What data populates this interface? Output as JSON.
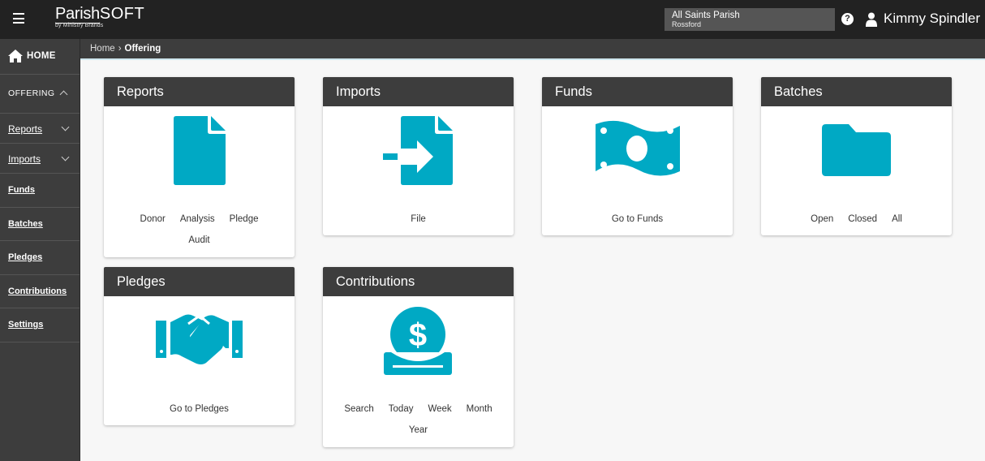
{
  "topbar": {
    "logo_main": "Parish",
    "logo_soft": "SOFT",
    "logo_by": "by Ministry Brands",
    "parish_name": "All Saints Parish",
    "parish_sub": "Rossford",
    "help_glyph": "?",
    "user_name": "Kimmy Spindler"
  },
  "sidebar": {
    "home": "HOME",
    "offering": "OFFERING",
    "items": [
      "Reports",
      "Imports",
      "Funds",
      "Batches",
      "Pledges",
      "Contributions",
      "Settings"
    ]
  },
  "breadcrumb": {
    "home": "Home",
    "current": "Offering"
  },
  "cards": {
    "reports": {
      "title": "Reports",
      "links": [
        "Donor",
        "Analysis",
        "Pledge",
        "Audit"
      ],
      "icon": "document-icon"
    },
    "imports": {
      "title": "Imports",
      "links": [
        "File"
      ],
      "icon": "file-import-icon"
    },
    "funds": {
      "title": "Funds",
      "links": [
        "Go to Funds"
      ],
      "icon": "money-bill-icon"
    },
    "batches": {
      "title": "Batches",
      "links": [
        "Open",
        "Closed",
        "All"
      ],
      "icon": "folder-icon"
    },
    "pledges": {
      "title": "Pledges",
      "links": [
        "Go to Pledges"
      ],
      "icon": "handshake-icon"
    },
    "contributions": {
      "title": "Contributions",
      "links": [
        "Search",
        "Today",
        "Week",
        "Month",
        "Year"
      ],
      "icon": "donate-coin-icon"
    }
  },
  "colors": {
    "accent": "#00a9c4",
    "header": "#222222",
    "card_head": "#3d3d3d"
  }
}
